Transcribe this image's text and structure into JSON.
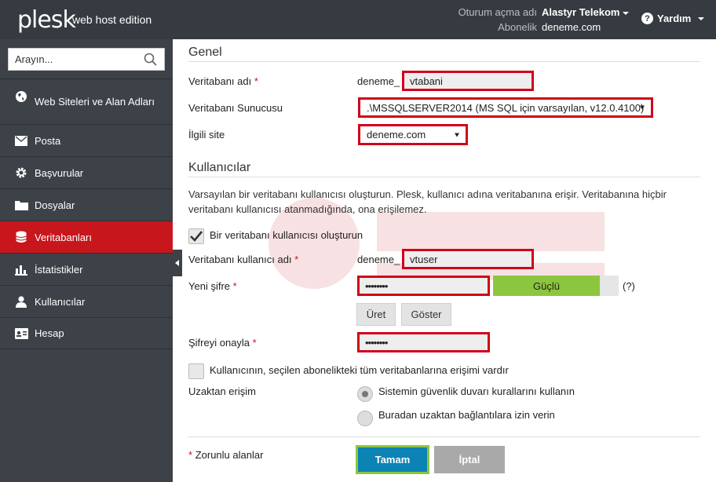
{
  "header": {
    "logo": "plesk",
    "edition": "web host edition",
    "login_label": "Oturum açma adı",
    "login_value": "Alastyr Telekom",
    "subscription_label": "Abonelik",
    "subscription_value": "deneme.com",
    "help_label": "Yardım"
  },
  "sidebar": {
    "search_placeholder": "Arayın...",
    "items": [
      {
        "label": "Web Siteleri ve Alan Adları",
        "icon": "globe-icon"
      },
      {
        "label": "Posta",
        "icon": "envelope-icon"
      },
      {
        "label": "Başvurular",
        "icon": "gear-icon"
      },
      {
        "label": "Dosyalar",
        "icon": "folder-icon"
      },
      {
        "label": "Veritabanları",
        "icon": "database-icon",
        "active": true
      },
      {
        "label": "İstatistikler",
        "icon": "bar-chart-icon"
      },
      {
        "label": "Kullanıcılar",
        "icon": "user-icon"
      },
      {
        "label": "Hesap",
        "icon": "id-card-icon"
      }
    ]
  },
  "form": {
    "general_title": "Genel",
    "db_name_label": "Veritabanı adı",
    "db_name_prefix": "deneme_",
    "db_name_value": "vtabani",
    "db_server_label": "Veritabanı Sunucusu",
    "db_server_value": ".\\MSSQLSERVER2014 (MS SQL için varsayılan, v12.0.4100)",
    "related_site_label": "İlgili site",
    "related_site_value": "deneme.com",
    "users_title": "Kullanıcılar",
    "users_description": "Varsayılan bir veritabanı kullanıcısı oluşturun. Plesk, kullanıcı adına veritabanına erişir. Veritabanına hiçbir veritabanı kullanıcısı atanmadığında, ona erişilemez.",
    "create_user_label": "Bir veritabanı kullanıcısı oluşturun",
    "create_user_checked": true,
    "db_user_label": "Veritabanı kullanıcı adı",
    "db_user_prefix": "deneme_",
    "db_user_value": "vtuser",
    "new_password_label": "Yeni şifre",
    "new_password_value": "••••••••",
    "strength_label": "Güçlü",
    "strength_fraction": 0.85,
    "strength_color": "#8cc63f",
    "help_mark": "(?)",
    "generate_button": "Üret",
    "show_button": "Göster",
    "confirm_password_label": "Şifreyi onayla",
    "confirm_password_value": "••••••••",
    "all_dbs_label": "Kullanıcının, seçilen abonelikteki tüm veritabanlarına erişimi vardır",
    "all_dbs_checked": false,
    "remote_access_label": "Uzaktan erişim",
    "remote_option_firewall": "Sistemin güvenlik duvarı kurallarını kullanın",
    "remote_option_allow": "Buradan uzaktan bağlantılara izin verin",
    "remote_selected": "firewall",
    "required_star": "*",
    "required_note": "Zorunlu alanlar",
    "ok_button": "Tamam",
    "cancel_button": "İptal"
  },
  "colors": {
    "topbar": "#353b40",
    "sidebar": "#3c4247",
    "active_nav": "#c8161d",
    "highlight_border": "#d0021b",
    "primary_button": "#0c83b5"
  }
}
